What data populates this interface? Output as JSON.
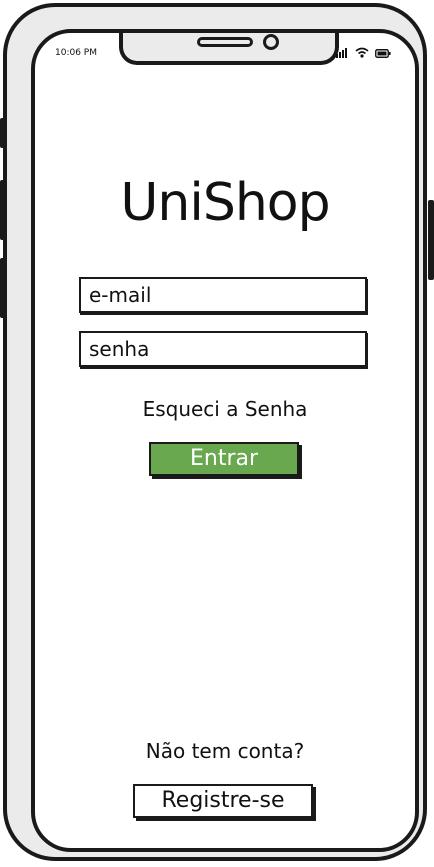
{
  "status_bar": {
    "time": "10:06 PM",
    "icons": [
      "signal-icon",
      "wifi-icon",
      "battery-icon"
    ]
  },
  "app": {
    "title": "UniShop"
  },
  "login_form": {
    "email_placeholder": "e-mail",
    "password_placeholder": "senha",
    "forgot_password_label": "Esqueci a Senha",
    "login_button_label": "Entrar"
  },
  "register": {
    "prompt": "Não tem conta?",
    "button_label": "Registre-se"
  },
  "colors": {
    "login_button": "#6aa84f",
    "outline": "#1a1a1a",
    "bezel": "#ebebeb"
  }
}
